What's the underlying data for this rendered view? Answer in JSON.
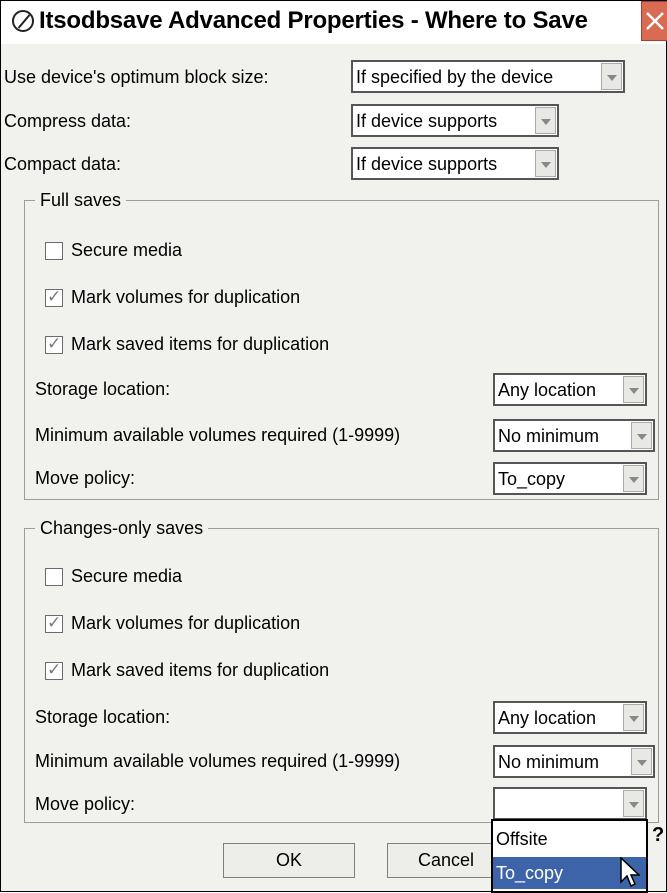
{
  "window": {
    "title": "Itsodbsave Advanced Properties - Where to Save"
  },
  "top": {
    "block_size_label": "Use device's optimum block size:",
    "block_size_value": "If specified by the device",
    "compress_label": "Compress data:",
    "compress_value": "If device supports",
    "compact_label": "Compact data:",
    "compact_value": "If device supports"
  },
  "full": {
    "title": "Full saves",
    "secure_label": "Secure media",
    "secure_checked": false,
    "mark_vol_label": "Mark volumes for duplication",
    "mark_vol_checked": true,
    "mark_items_label": "Mark saved items for duplication",
    "mark_items_checked": true,
    "storage_label": "Storage location:",
    "storage_value": "Any location",
    "min_vol_label": "Minimum available volumes required (1-9999)",
    "min_vol_value": "No minimum",
    "move_label": "Move policy:",
    "move_value": "To_copy"
  },
  "changes": {
    "title": "Changes-only saves",
    "secure_label": "Secure media",
    "secure_checked": false,
    "mark_vol_label": "Mark volumes for duplication",
    "mark_vol_checked": true,
    "mark_items_label": "Mark saved items for duplication",
    "mark_items_checked": true,
    "storage_label": "Storage location:",
    "storage_value": "Any location",
    "min_vol_label": "Minimum available volumes required (1-9999)",
    "min_vol_value": "No minimum",
    "move_label": "Move policy:",
    "move_value": "",
    "move_options": [
      "Offsite",
      "To_copy"
    ],
    "move_highlighted": "To_copy"
  },
  "buttons": {
    "ok": "OK",
    "cancel": "Cancel",
    "help": "?"
  },
  "checkmark": "✓"
}
